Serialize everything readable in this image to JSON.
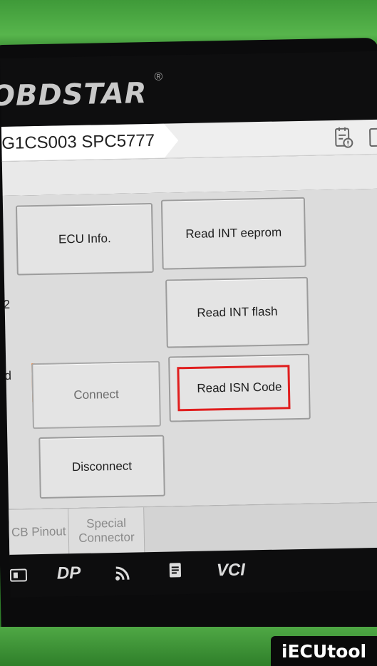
{
  "header": {
    "logo_text": "OBDSTAR",
    "logo_mark": "®"
  },
  "tabbar": {
    "title": "G1CS003 SPC5777",
    "report_icon": "report-clipboard-icon"
  },
  "buttons": {
    "ecu_info": "ECU Info.",
    "read_int_eeprom": "Read INT eeprom",
    "read_int_flash": "Read INT flash",
    "connect": "Connect",
    "read_isn_code": "Read ISN Code",
    "disconnect": "Disconnect"
  },
  "left_partial": {
    "line1": "2",
    "line2": "d"
  },
  "bottom_tabs": {
    "tab1": "CB Pinout",
    "tab2_line1": "Special",
    "tab2_line2": "Connector"
  },
  "system_bar": {
    "icons": [
      "screen-icon",
      "dp-icon",
      "wifi-icon",
      "document-icon",
      "vci-icon"
    ],
    "dp_label": "DP",
    "vci_label": "VCI"
  },
  "highlight_color": "#e01e1e",
  "watermark": "iECUtool"
}
